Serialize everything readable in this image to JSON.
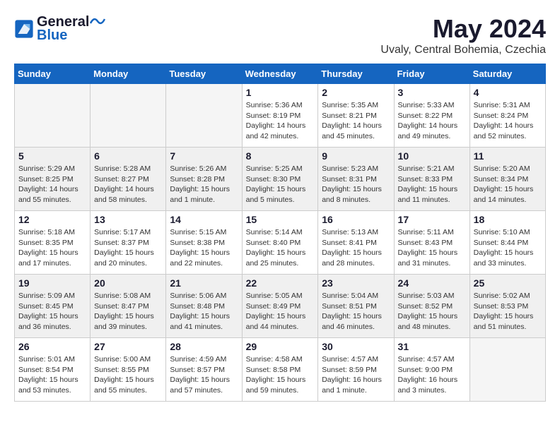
{
  "header": {
    "logo_line1": "General",
    "logo_line2": "Blue",
    "month": "May 2024",
    "location": "Uvaly, Central Bohemia, Czechia"
  },
  "weekdays": [
    "Sunday",
    "Monday",
    "Tuesday",
    "Wednesday",
    "Thursday",
    "Friday",
    "Saturday"
  ],
  "weeks": [
    [
      {
        "day": "",
        "info": ""
      },
      {
        "day": "",
        "info": ""
      },
      {
        "day": "",
        "info": ""
      },
      {
        "day": "1",
        "info": "Sunrise: 5:36 AM\nSunset: 8:19 PM\nDaylight: 14 hours\nand 42 minutes."
      },
      {
        "day": "2",
        "info": "Sunrise: 5:35 AM\nSunset: 8:21 PM\nDaylight: 14 hours\nand 45 minutes."
      },
      {
        "day": "3",
        "info": "Sunrise: 5:33 AM\nSunset: 8:22 PM\nDaylight: 14 hours\nand 49 minutes."
      },
      {
        "day": "4",
        "info": "Sunrise: 5:31 AM\nSunset: 8:24 PM\nDaylight: 14 hours\nand 52 minutes."
      }
    ],
    [
      {
        "day": "5",
        "info": "Sunrise: 5:29 AM\nSunset: 8:25 PM\nDaylight: 14 hours\nand 55 minutes."
      },
      {
        "day": "6",
        "info": "Sunrise: 5:28 AM\nSunset: 8:27 PM\nDaylight: 14 hours\nand 58 minutes."
      },
      {
        "day": "7",
        "info": "Sunrise: 5:26 AM\nSunset: 8:28 PM\nDaylight: 15 hours\nand 1 minute."
      },
      {
        "day": "8",
        "info": "Sunrise: 5:25 AM\nSunset: 8:30 PM\nDaylight: 15 hours\nand 5 minutes."
      },
      {
        "day": "9",
        "info": "Sunrise: 5:23 AM\nSunset: 8:31 PM\nDaylight: 15 hours\nand 8 minutes."
      },
      {
        "day": "10",
        "info": "Sunrise: 5:21 AM\nSunset: 8:33 PM\nDaylight: 15 hours\nand 11 minutes."
      },
      {
        "day": "11",
        "info": "Sunrise: 5:20 AM\nSunset: 8:34 PM\nDaylight: 15 hours\nand 14 minutes."
      }
    ],
    [
      {
        "day": "12",
        "info": "Sunrise: 5:18 AM\nSunset: 8:35 PM\nDaylight: 15 hours\nand 17 minutes."
      },
      {
        "day": "13",
        "info": "Sunrise: 5:17 AM\nSunset: 8:37 PM\nDaylight: 15 hours\nand 20 minutes."
      },
      {
        "day": "14",
        "info": "Sunrise: 5:15 AM\nSunset: 8:38 PM\nDaylight: 15 hours\nand 22 minutes."
      },
      {
        "day": "15",
        "info": "Sunrise: 5:14 AM\nSunset: 8:40 PM\nDaylight: 15 hours\nand 25 minutes."
      },
      {
        "day": "16",
        "info": "Sunrise: 5:13 AM\nSunset: 8:41 PM\nDaylight: 15 hours\nand 28 minutes."
      },
      {
        "day": "17",
        "info": "Sunrise: 5:11 AM\nSunset: 8:43 PM\nDaylight: 15 hours\nand 31 minutes."
      },
      {
        "day": "18",
        "info": "Sunrise: 5:10 AM\nSunset: 8:44 PM\nDaylight: 15 hours\nand 33 minutes."
      }
    ],
    [
      {
        "day": "19",
        "info": "Sunrise: 5:09 AM\nSunset: 8:45 PM\nDaylight: 15 hours\nand 36 minutes."
      },
      {
        "day": "20",
        "info": "Sunrise: 5:08 AM\nSunset: 8:47 PM\nDaylight: 15 hours\nand 39 minutes."
      },
      {
        "day": "21",
        "info": "Sunrise: 5:06 AM\nSunset: 8:48 PM\nDaylight: 15 hours\nand 41 minutes."
      },
      {
        "day": "22",
        "info": "Sunrise: 5:05 AM\nSunset: 8:49 PM\nDaylight: 15 hours\nand 44 minutes."
      },
      {
        "day": "23",
        "info": "Sunrise: 5:04 AM\nSunset: 8:51 PM\nDaylight: 15 hours\nand 46 minutes."
      },
      {
        "day": "24",
        "info": "Sunrise: 5:03 AM\nSunset: 8:52 PM\nDaylight: 15 hours\nand 48 minutes."
      },
      {
        "day": "25",
        "info": "Sunrise: 5:02 AM\nSunset: 8:53 PM\nDaylight: 15 hours\nand 51 minutes."
      }
    ],
    [
      {
        "day": "26",
        "info": "Sunrise: 5:01 AM\nSunset: 8:54 PM\nDaylight: 15 hours\nand 53 minutes."
      },
      {
        "day": "27",
        "info": "Sunrise: 5:00 AM\nSunset: 8:55 PM\nDaylight: 15 hours\nand 55 minutes."
      },
      {
        "day": "28",
        "info": "Sunrise: 4:59 AM\nSunset: 8:57 PM\nDaylight: 15 hours\nand 57 minutes."
      },
      {
        "day": "29",
        "info": "Sunrise: 4:58 AM\nSunset: 8:58 PM\nDaylight: 15 hours\nand 59 minutes."
      },
      {
        "day": "30",
        "info": "Sunrise: 4:57 AM\nSunset: 8:59 PM\nDaylight: 16 hours\nand 1 minute."
      },
      {
        "day": "31",
        "info": "Sunrise: 4:57 AM\nSunset: 9:00 PM\nDaylight: 16 hours\nand 3 minutes."
      },
      {
        "day": "",
        "info": ""
      }
    ]
  ]
}
